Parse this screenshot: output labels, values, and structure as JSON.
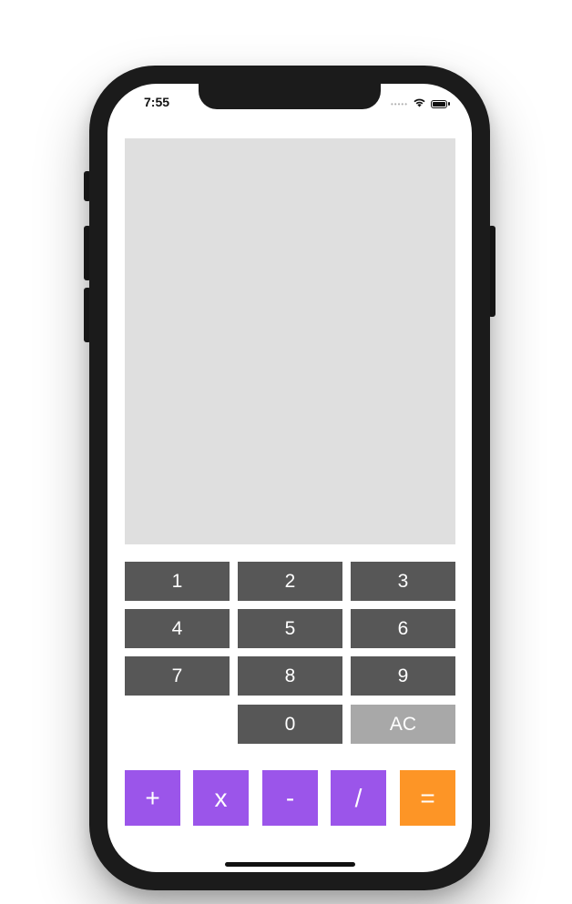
{
  "status_bar": {
    "time": "7:55",
    "signal_icon": "signal-dots-icon",
    "wifi_icon": "wifi-icon",
    "battery_icon": "battery-icon"
  },
  "display": {
    "value": ""
  },
  "keypad": {
    "keys": [
      "1",
      "2",
      "3",
      "4",
      "5",
      "6",
      "7",
      "8",
      "9",
      "0",
      "AC"
    ]
  },
  "operators": {
    "plus": "+",
    "multiply": "x",
    "minus": "-",
    "divide": "/",
    "equals": "="
  },
  "colors": {
    "digit_key": "#575757",
    "clear_key": "#a8a8a8",
    "operator_key": "#9b55ea",
    "equals_key": "#fd9526",
    "display_bg": "#dfdfdf",
    "phone_frame": "#1b1b1b"
  }
}
